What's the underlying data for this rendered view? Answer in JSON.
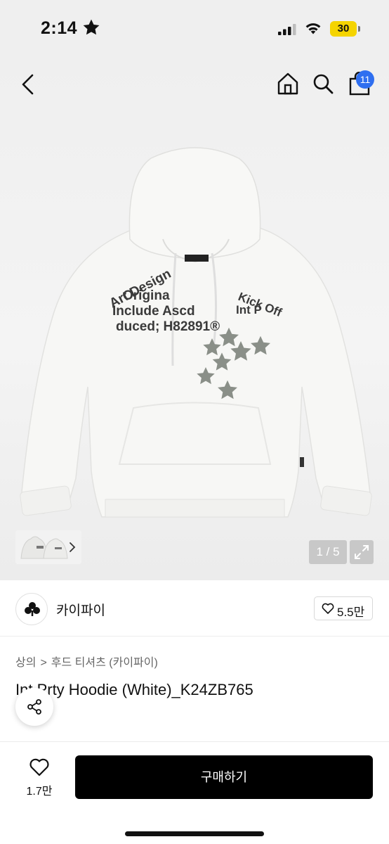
{
  "status_bar": {
    "time": "2:14",
    "battery": "30"
  },
  "header": {
    "cart_count": "11"
  },
  "gallery": {
    "page_indicator": "1 / 5",
    "hoodie_print_lines": [
      "Art Design",
      "Origina",
      "Include Ascd",
      "duced; H82891®",
      "Kick Off",
      "Int P"
    ]
  },
  "store": {
    "name": "카이파이",
    "likes": "5.5만"
  },
  "breadcrumb": {
    "level1": "상의",
    "separator": ">",
    "level2": "후드 티셔츠 (카이파이)"
  },
  "product": {
    "title": "Int Prty Hoodie (White)_K24ZB765"
  },
  "bottom": {
    "likes": "1.7만",
    "buy_label": "구매하기"
  },
  "colors": {
    "accent_badge": "#2f6ff0",
    "buy_button": "#000000",
    "hoodie": "#f7f7f5",
    "star_print": "#8a8f88"
  },
  "icons": [
    "star-icon",
    "signal-icon",
    "wifi-icon",
    "back-icon",
    "home-icon",
    "search-icon",
    "bag-icon",
    "chevron-right-icon",
    "expand-icon",
    "clover-icon",
    "heart-icon",
    "share-icon"
  ]
}
